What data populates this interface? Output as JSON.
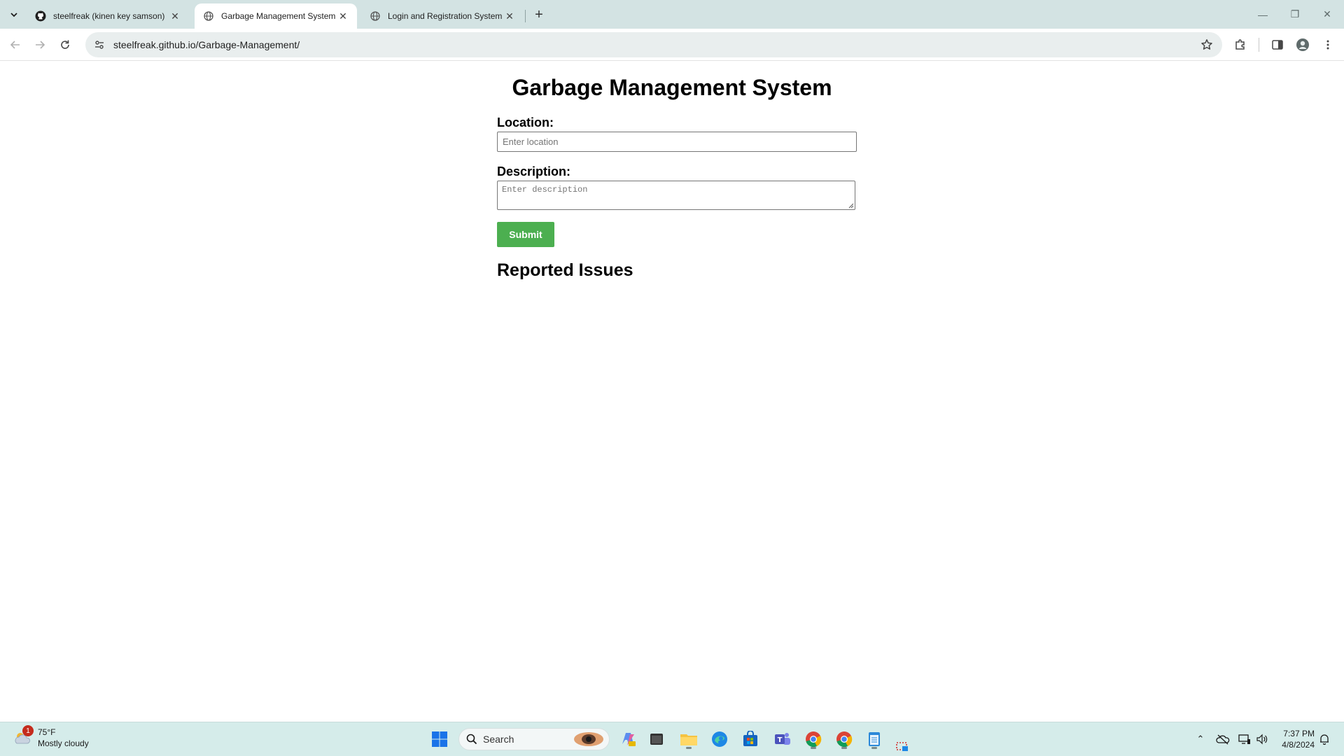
{
  "browser": {
    "tabs": [
      {
        "title": "steelfreak (kinen key samson)",
        "favicon": "github-icon",
        "active": false
      },
      {
        "title": "Garbage Management System",
        "favicon": "globe-icon",
        "active": true
      },
      {
        "title": "Login and Registration System",
        "favicon": "globe-icon",
        "active": false
      }
    ],
    "url": "steelfreak.github.io/Garbage-Management/"
  },
  "page": {
    "title": "Garbage Management System",
    "location_label": "Location:",
    "location_placeholder": "Enter location",
    "description_label": "Description:",
    "description_placeholder": "Enter description",
    "submit_label": "Submit",
    "issues_title": "Reported Issues",
    "accent_color": "#4caf50"
  },
  "taskbar": {
    "weather": {
      "temp": "75°F",
      "condition": "Mostly cloudy",
      "badge": "1"
    },
    "search_label": "Search",
    "clock": {
      "time": "7:37 PM",
      "date": "4/8/2024"
    }
  }
}
